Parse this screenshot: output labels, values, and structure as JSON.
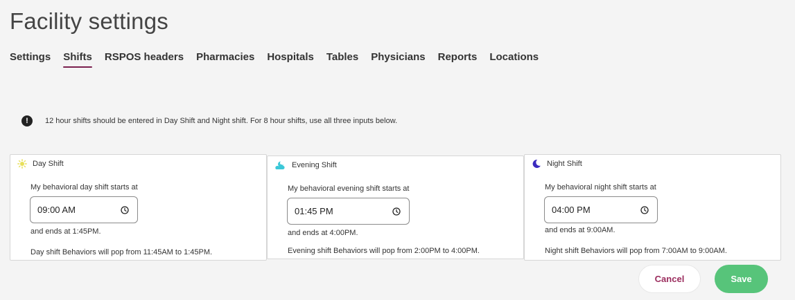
{
  "page": {
    "title": "Facility settings"
  },
  "tabs": [
    {
      "label": "Settings",
      "active": false
    },
    {
      "label": "Shifts",
      "active": true
    },
    {
      "label": "RSPOS headers",
      "active": false
    },
    {
      "label": "Pharmacies",
      "active": false
    },
    {
      "label": "Hospitals",
      "active": false
    },
    {
      "label": "Tables",
      "active": false
    },
    {
      "label": "Physicians",
      "active": false
    },
    {
      "label": "Reports",
      "active": false
    },
    {
      "label": "Locations",
      "active": false
    }
  ],
  "notice": {
    "icon": "exclamation-icon",
    "text": "12 hour shifts should be entered in Day Shift and Night shift. For 8 hour shifts, use all three inputs below."
  },
  "shifts": {
    "day": {
      "title": "Day Shift",
      "icon": "sun-icon",
      "label": "My behavioral day shift starts at",
      "start_time": "09:00 AM",
      "ends": "and ends at 1:45PM.",
      "note": "Day shift Behaviors will pop from 11:45AM to 1:45PM."
    },
    "evening": {
      "title": "Evening Shift",
      "icon": "cloud-moon-icon",
      "label": "My behavioral evening shift starts at",
      "start_time": "01:45 PM",
      "ends": "and ends at 4:00PM.",
      "note": "Evening shift Behaviors will pop from 2:00PM to 4:00PM."
    },
    "night": {
      "title": "Night Shift",
      "icon": "moon-icon",
      "label": "My behavioral night shift starts at",
      "start_time": "04:00 PM",
      "ends": "and ends at 9:00AM.",
      "note": "Night shift Behaviors will pop from 7:00AM to 9:00AM."
    }
  },
  "actions": {
    "cancel_label": "Cancel",
    "save_label": "Save"
  },
  "colors": {
    "tab_active_underline": "#7a1f4e",
    "cancel_text": "#9b2d5e",
    "save_bg": "#57c47a",
    "sun": "#e8e05a",
    "cloud": "#3cc8d8",
    "moon": "#3b2bbf"
  }
}
